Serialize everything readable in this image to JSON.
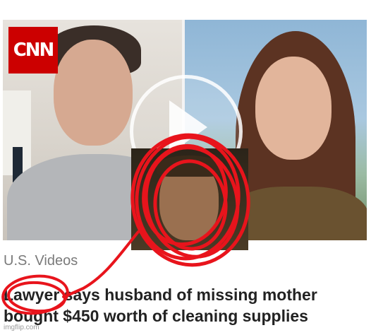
{
  "logo": {
    "text": "CNN",
    "color": "#cc0000"
  },
  "video": {
    "play_icon": "play-icon"
  },
  "card": {
    "section_label": "U.S. Videos",
    "headline": "Lawyer says husband of missing mother bought $450 worth of cleaning supplies"
  },
  "annotation": {
    "color": "#e8141c"
  },
  "watermark": "imgflip.com"
}
